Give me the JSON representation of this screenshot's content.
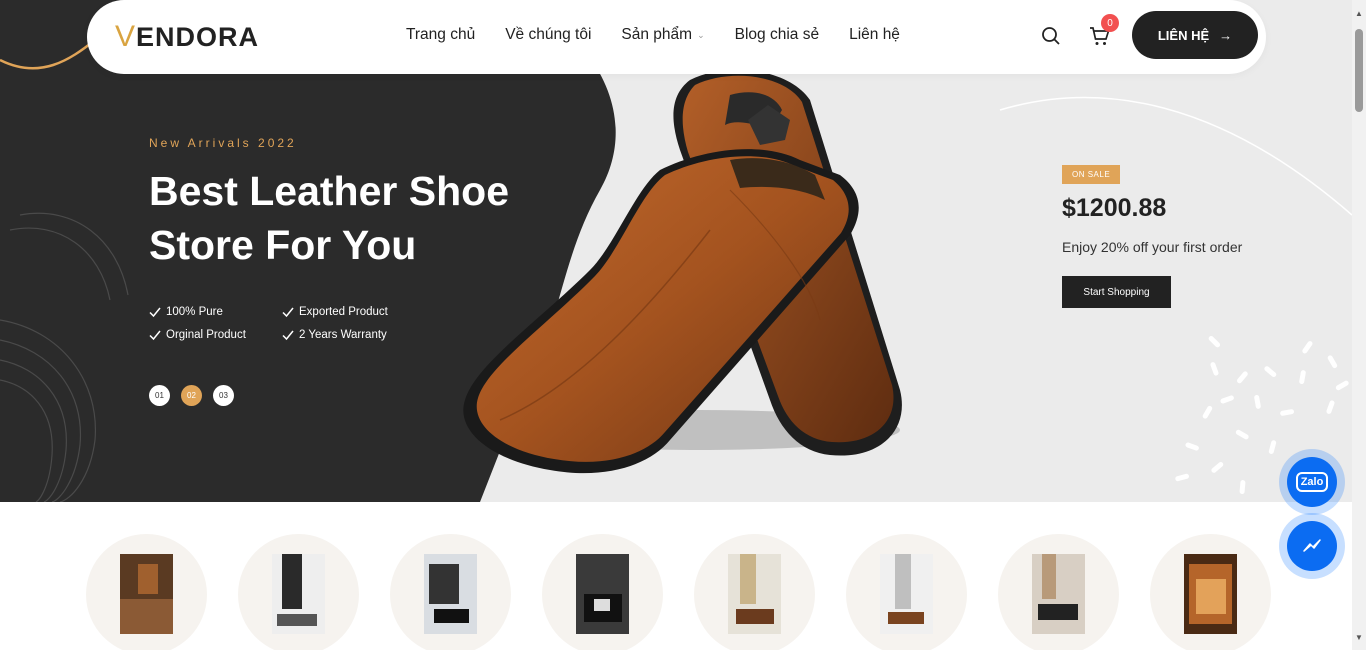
{
  "header": {
    "logo_v": "V",
    "logo_rest": "ENDORA",
    "nav": [
      "Trang chủ",
      "Về chúng tôi",
      "Sản phẩm",
      "Blog chia sẻ",
      "Liên hệ"
    ],
    "cart_count": "0",
    "contact_label": "LIÊN HỆ"
  },
  "hero": {
    "eyebrow": "New Arrivals 2022",
    "title_line1": "Best Leather Shoe",
    "title_line2": "Store For You",
    "features": [
      "100% Pure",
      "Exported Product",
      "Orginal Product",
      "2 Years Warranty"
    ],
    "slides": [
      "01",
      "02",
      "03"
    ],
    "active_slide": "02",
    "badge": "ON SALE",
    "price": "$1200.88",
    "offer": "Enjoy 20% off your first order",
    "cta": "Start Shopping"
  },
  "colors": {
    "accent": "#e0a458",
    "dark": "#222222",
    "hero_dark": "#2b2b2b",
    "badge_red": "#f25050",
    "messenger_blue": "#0b6cf2"
  },
  "icons": {
    "search": "search-icon",
    "cart": "cart-icon",
    "arrow": "arrow-right-icon",
    "zalo": "zalo-icon",
    "messenger": "messenger-icon"
  },
  "floating": {
    "zalo_label": "Zalo"
  },
  "categories_count": 8
}
